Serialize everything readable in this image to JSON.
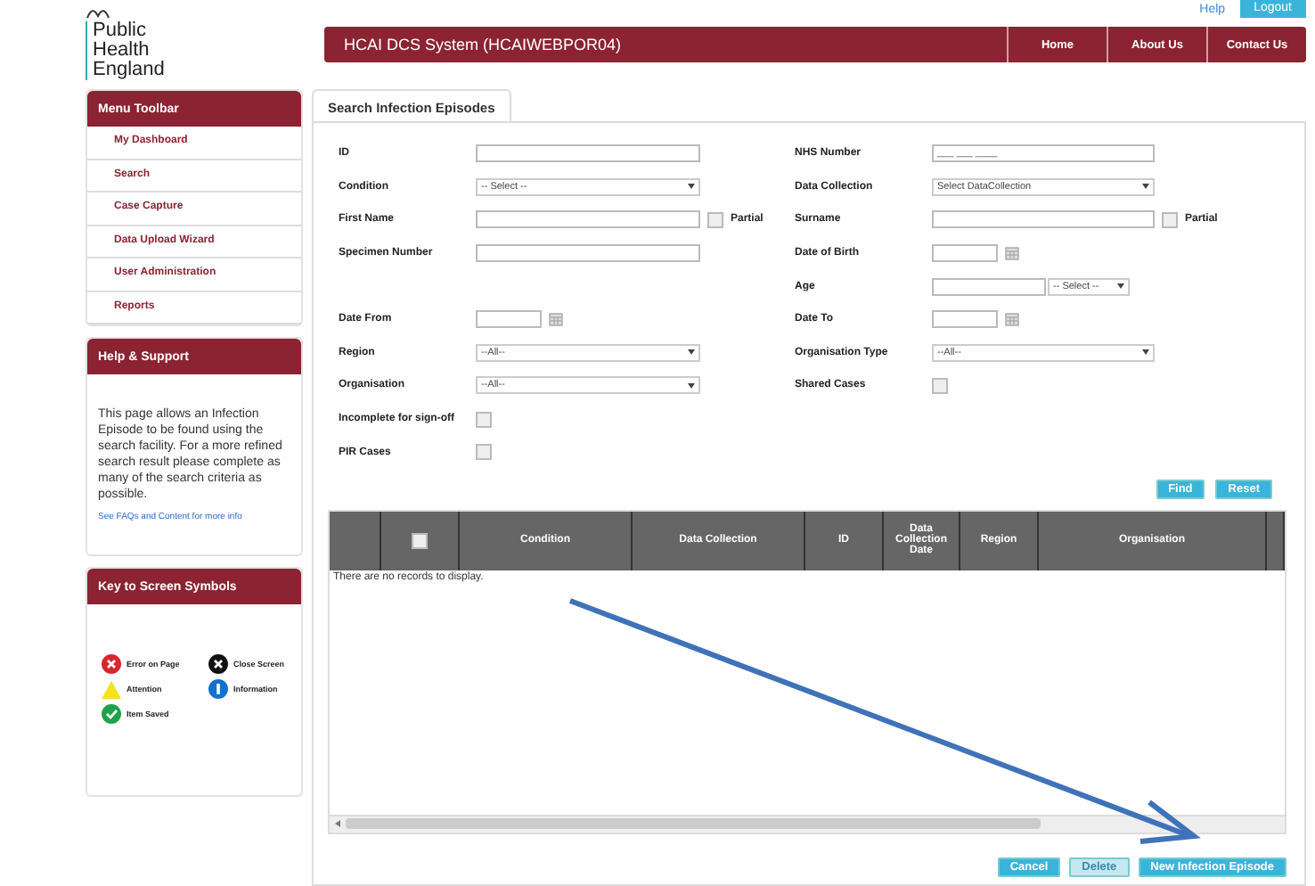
{
  "header": {
    "logo_text": "Public Health England",
    "top_links": [
      "Help",
      "Logout"
    ],
    "app_title": "HCAI DCS System (HCAIWEBPOR04)",
    "nav": [
      "Home",
      "About Us",
      "Contact Us"
    ]
  },
  "sidebar": {
    "menu": {
      "title": "Menu Toolbar",
      "items": [
        "My Dashboard",
        "Search",
        "Case Capture",
        "Data Upload Wizard",
        "User Administration",
        "Reports"
      ]
    },
    "help": {
      "title": "Help & Support",
      "text": "This page allows an Infection Episode to be found using the search facility.  For a more refined search result please complete as many of the search criteria as possible.",
      "link": "See FAQs and Content for more info"
    },
    "key": {
      "title": "Key to Screen Symbols",
      "symbols": [
        {
          "kind": "error",
          "label": "Error on Page"
        },
        {
          "kind": "close",
          "label": "Close Screen"
        },
        {
          "kind": "attention",
          "label": "Attention"
        },
        {
          "kind": "information",
          "label": "Information"
        },
        {
          "kind": "saved",
          "label": "Item Saved"
        }
      ]
    }
  },
  "tabs": [
    {
      "label": "Search Infection Episodes",
      "selected": true
    }
  ],
  "form": {
    "rows": [
      {
        "left": {
          "label": "ID",
          "kind": "text"
        },
        "right": {
          "label": "NHS Number",
          "kind": "text",
          "placeholder": "___ ___ ____"
        }
      },
      {
        "left": {
          "label": "Condition",
          "kind": "select",
          "value": "-- Select --"
        },
        "right": {
          "label": "Data Collection",
          "kind": "select",
          "value": "Select DataCollection"
        }
      },
      {
        "left": {
          "label": "First Name",
          "kind": "text",
          "partial": {
            "label": "Partial",
            "checked": false
          }
        },
        "right": {
          "label": "Surname",
          "kind": "text",
          "partial": {
            "label": "Partial",
            "checked": false
          }
        }
      },
      {
        "left": {
          "label": "Specimen Number",
          "kind": "text"
        },
        "right": {
          "label": "Date of Birth",
          "kind": "date"
        }
      },
      {
        "right": {
          "label": "Age",
          "kind": "age",
          "value": "-- Select --"
        }
      },
      {
        "left": {
          "label": "Date From",
          "kind": "date"
        },
        "right": {
          "label": "Date To",
          "kind": "date"
        }
      },
      {
        "left": {
          "label": "Region",
          "kind": "select",
          "value": "--All--"
        },
        "right": {
          "label": "Organisation Type",
          "kind": "select",
          "value": "--All--"
        }
      },
      {
        "left": {
          "label": "Organisation",
          "kind": "select",
          "value": "--All--"
        },
        "right": {
          "label": "Shared Cases",
          "kind": "checkbox",
          "checked": false
        }
      },
      {
        "left": {
          "label": "Incomplete for sign-off",
          "kind": "checkbox",
          "checked": false
        }
      },
      {
        "left": {
          "label": "PIR Cases",
          "kind": "checkbox",
          "checked": false
        }
      }
    ],
    "buttons": [
      "Find",
      "Reset"
    ]
  },
  "grid": {
    "columns": [
      {
        "kind": "blank"
      },
      {
        "kind": "select_all",
        "checked": false
      },
      {
        "kind": "text",
        "label": "Condition"
      },
      {
        "kind": "text",
        "label": "Data Collection"
      },
      {
        "kind": "text",
        "label": "ID"
      },
      {
        "kind": "text",
        "label": "Data Collection Date"
      },
      {
        "kind": "text",
        "label": "Region"
      },
      {
        "kind": "text",
        "label": "Organisation"
      },
      {
        "kind": "blank"
      }
    ],
    "empty_message": "There are no records to display."
  },
  "footer_buttons": [
    {
      "label": "Cancel",
      "disabled": false
    },
    {
      "label": "Delete",
      "disabled": true
    },
    {
      "label": "New Infection Episode",
      "disabled": false
    }
  ]
}
